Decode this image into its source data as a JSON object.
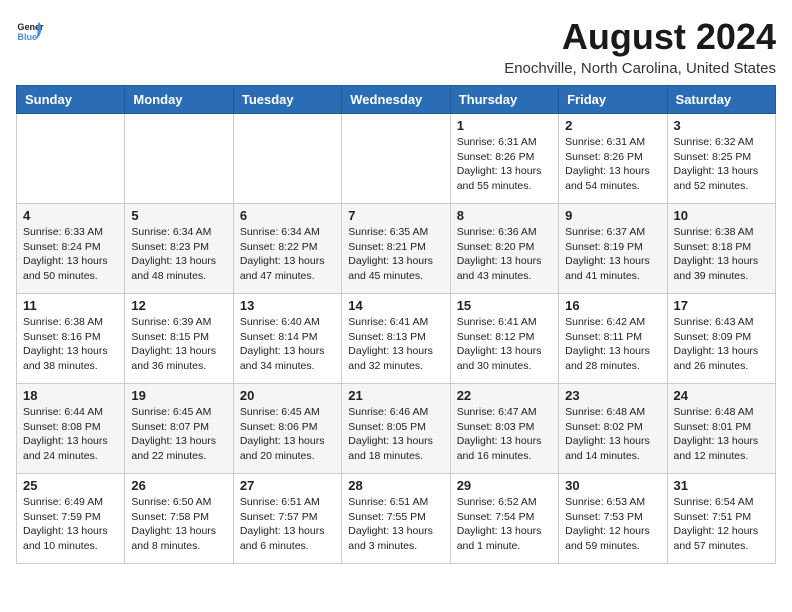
{
  "header": {
    "logo_line1": "General",
    "logo_line2": "Blue",
    "title": "August 2024",
    "subtitle": "Enochville, North Carolina, United States"
  },
  "weekdays": [
    "Sunday",
    "Monday",
    "Tuesday",
    "Wednesday",
    "Thursday",
    "Friday",
    "Saturday"
  ],
  "weeks": [
    [
      {
        "day": "",
        "info": ""
      },
      {
        "day": "",
        "info": ""
      },
      {
        "day": "",
        "info": ""
      },
      {
        "day": "",
        "info": ""
      },
      {
        "day": "1",
        "info": "Sunrise: 6:31 AM\nSunset: 8:26 PM\nDaylight: 13 hours\nand 55 minutes."
      },
      {
        "day": "2",
        "info": "Sunrise: 6:31 AM\nSunset: 8:26 PM\nDaylight: 13 hours\nand 54 minutes."
      },
      {
        "day": "3",
        "info": "Sunrise: 6:32 AM\nSunset: 8:25 PM\nDaylight: 13 hours\nand 52 minutes."
      }
    ],
    [
      {
        "day": "4",
        "info": "Sunrise: 6:33 AM\nSunset: 8:24 PM\nDaylight: 13 hours\nand 50 minutes."
      },
      {
        "day": "5",
        "info": "Sunrise: 6:34 AM\nSunset: 8:23 PM\nDaylight: 13 hours\nand 48 minutes."
      },
      {
        "day": "6",
        "info": "Sunrise: 6:34 AM\nSunset: 8:22 PM\nDaylight: 13 hours\nand 47 minutes."
      },
      {
        "day": "7",
        "info": "Sunrise: 6:35 AM\nSunset: 8:21 PM\nDaylight: 13 hours\nand 45 minutes."
      },
      {
        "day": "8",
        "info": "Sunrise: 6:36 AM\nSunset: 8:20 PM\nDaylight: 13 hours\nand 43 minutes."
      },
      {
        "day": "9",
        "info": "Sunrise: 6:37 AM\nSunset: 8:19 PM\nDaylight: 13 hours\nand 41 minutes."
      },
      {
        "day": "10",
        "info": "Sunrise: 6:38 AM\nSunset: 8:18 PM\nDaylight: 13 hours\nand 39 minutes."
      }
    ],
    [
      {
        "day": "11",
        "info": "Sunrise: 6:38 AM\nSunset: 8:16 PM\nDaylight: 13 hours\nand 38 minutes."
      },
      {
        "day": "12",
        "info": "Sunrise: 6:39 AM\nSunset: 8:15 PM\nDaylight: 13 hours\nand 36 minutes."
      },
      {
        "day": "13",
        "info": "Sunrise: 6:40 AM\nSunset: 8:14 PM\nDaylight: 13 hours\nand 34 minutes."
      },
      {
        "day": "14",
        "info": "Sunrise: 6:41 AM\nSunset: 8:13 PM\nDaylight: 13 hours\nand 32 minutes."
      },
      {
        "day": "15",
        "info": "Sunrise: 6:41 AM\nSunset: 8:12 PM\nDaylight: 13 hours\nand 30 minutes."
      },
      {
        "day": "16",
        "info": "Sunrise: 6:42 AM\nSunset: 8:11 PM\nDaylight: 13 hours\nand 28 minutes."
      },
      {
        "day": "17",
        "info": "Sunrise: 6:43 AM\nSunset: 8:09 PM\nDaylight: 13 hours\nand 26 minutes."
      }
    ],
    [
      {
        "day": "18",
        "info": "Sunrise: 6:44 AM\nSunset: 8:08 PM\nDaylight: 13 hours\nand 24 minutes."
      },
      {
        "day": "19",
        "info": "Sunrise: 6:45 AM\nSunset: 8:07 PM\nDaylight: 13 hours\nand 22 minutes."
      },
      {
        "day": "20",
        "info": "Sunrise: 6:45 AM\nSunset: 8:06 PM\nDaylight: 13 hours\nand 20 minutes."
      },
      {
        "day": "21",
        "info": "Sunrise: 6:46 AM\nSunset: 8:05 PM\nDaylight: 13 hours\nand 18 minutes."
      },
      {
        "day": "22",
        "info": "Sunrise: 6:47 AM\nSunset: 8:03 PM\nDaylight: 13 hours\nand 16 minutes."
      },
      {
        "day": "23",
        "info": "Sunrise: 6:48 AM\nSunset: 8:02 PM\nDaylight: 13 hours\nand 14 minutes."
      },
      {
        "day": "24",
        "info": "Sunrise: 6:48 AM\nSunset: 8:01 PM\nDaylight: 13 hours\nand 12 minutes."
      }
    ],
    [
      {
        "day": "25",
        "info": "Sunrise: 6:49 AM\nSunset: 7:59 PM\nDaylight: 13 hours\nand 10 minutes."
      },
      {
        "day": "26",
        "info": "Sunrise: 6:50 AM\nSunset: 7:58 PM\nDaylight: 13 hours\nand 8 minutes."
      },
      {
        "day": "27",
        "info": "Sunrise: 6:51 AM\nSunset: 7:57 PM\nDaylight: 13 hours\nand 6 minutes."
      },
      {
        "day": "28",
        "info": "Sunrise: 6:51 AM\nSunset: 7:55 PM\nDaylight: 13 hours\nand 3 minutes."
      },
      {
        "day": "29",
        "info": "Sunrise: 6:52 AM\nSunset: 7:54 PM\nDaylight: 13 hours\nand 1 minute."
      },
      {
        "day": "30",
        "info": "Sunrise: 6:53 AM\nSunset: 7:53 PM\nDaylight: 12 hours\nand 59 minutes."
      },
      {
        "day": "31",
        "info": "Sunrise: 6:54 AM\nSunset: 7:51 PM\nDaylight: 12 hours\nand 57 minutes."
      }
    ]
  ]
}
